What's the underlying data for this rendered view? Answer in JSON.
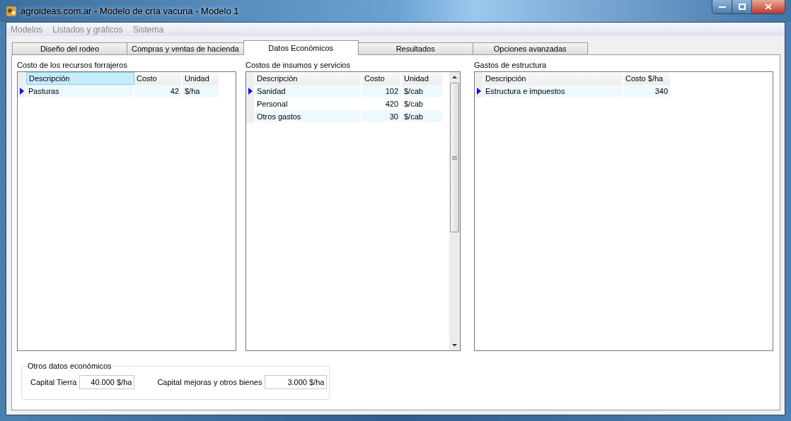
{
  "window": {
    "title": "agroideas.com.ar - Modelo de cría vacuna - Modelo 1"
  },
  "menu": [
    "Modelos",
    "Listados y gráficos",
    "Sistema"
  ],
  "tabs": [
    {
      "label": "Diseño del rodeo",
      "selected": false
    },
    {
      "label": "Compras y ventas de hacienda",
      "selected": false
    },
    {
      "label": "Datos Económicos",
      "selected": true
    },
    {
      "label": "Resultados",
      "selected": false
    },
    {
      "label": "Opciones avanzadas",
      "selected": false
    }
  ],
  "grids": [
    {
      "title": "Costo de los recursos forrajeros",
      "scrollbar": false,
      "columns": [
        {
          "label": "Descripción",
          "selected": true
        },
        {
          "label": "Costo",
          "selected": false
        },
        {
          "label": "Unidad",
          "selected": false
        }
      ],
      "rows": [
        {
          "selected": true,
          "cells": [
            "Pasturas",
            "42",
            "$/ha"
          ]
        }
      ]
    },
    {
      "title": "Costos de insumos y servicios",
      "scrollbar": true,
      "columns": [
        {
          "label": "Descripción",
          "selected": false
        },
        {
          "label": "Costo",
          "selected": false
        },
        {
          "label": "Unidad",
          "selected": false
        }
      ],
      "rows": [
        {
          "selected": true,
          "cells": [
            "Sanidad",
            "102",
            "$/cab"
          ]
        },
        {
          "selected": false,
          "cells": [
            "Personal",
            "420",
            "$/cab"
          ]
        },
        {
          "selected": false,
          "cells": [
            "Otros gastos",
            "30",
            "$/cab"
          ]
        }
      ]
    },
    {
      "title": "Gastos de estructura",
      "scrollbar": false,
      "columns": [
        {
          "label": "Descripción",
          "selected": false
        },
        {
          "label": "Costo $/ha",
          "selected": false
        }
      ],
      "rows": [
        {
          "selected": true,
          "cells": [
            "Estructura e impuestos",
            "340"
          ]
        }
      ]
    }
  ],
  "other": {
    "title": "Otros datos económicos",
    "fields": [
      {
        "label": "Capital Tierra",
        "value": "40.000 $/ha"
      },
      {
        "label": "Capital mejoras y otros bienes",
        "value": "3.000 $/ha"
      }
    ]
  }
}
